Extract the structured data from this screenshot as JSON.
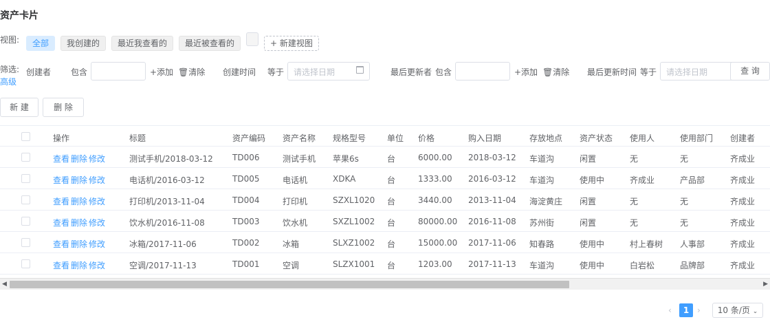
{
  "page_title": "资产卡片",
  "views": {
    "label": "视图:",
    "items": [
      "全部",
      "我创建的",
      "最近我查看的",
      "最近被查看的"
    ],
    "new_view": "+ 新建视图"
  },
  "filter": {
    "label": "筛选:",
    "advanced": "高级",
    "creator_label": "创建者",
    "creator_op": "包含",
    "add": "+添加",
    "clear": "清除",
    "created_label": "创建时间",
    "created_op": "等于",
    "date_placeholder": "请选择日期",
    "updater_label": "最后更新者",
    "updater_op": "包含",
    "updated_label": "最后更新时间",
    "updated_op": "等于",
    "query": "查 询"
  },
  "toolbar": {
    "new": "新 建",
    "delete": "删 除"
  },
  "table": {
    "headers": [
      "操作",
      "标题",
      "资产编码",
      "资产名称",
      "规格型号",
      "单位",
      "价格",
      "购入日期",
      "存放地点",
      "资产状态",
      "使用人",
      "使用部门",
      "创建者"
    ],
    "actions": [
      "查看",
      "删除",
      "修改"
    ],
    "rows": [
      [
        "测试手机/2018-03-12",
        "TD006",
        "测试手机",
        "苹果6s",
        "台",
        "6000.00",
        "2018-03-12",
        "车道沟",
        "闲置",
        "无",
        "无",
        "齐成业"
      ],
      [
        "电话机/2016-03-12",
        "TD005",
        "电话机",
        "XDKA",
        "台",
        "1333.00",
        "2016-03-12",
        "车道沟",
        "使用中",
        "齐成业",
        "产品部",
        "齐成业"
      ],
      [
        "打印机/2013-11-04",
        "TD004",
        "打印机",
        "SZXL1020",
        "台",
        "3440.00",
        "2013-11-04",
        "海淀黄庄",
        "闲置",
        "无",
        "无",
        "齐成业"
      ],
      [
        "饮水机/2016-11-08",
        "TD003",
        "饮水机",
        "SXZL1002",
        "台",
        "80000.00",
        "2016-11-08",
        "苏州街",
        "闲置",
        "无",
        "无",
        "齐成业"
      ],
      [
        "冰箱/2017-11-06",
        "TD002",
        "冰箱",
        "SLXZ1002",
        "台",
        "15000.00",
        "2017-11-06",
        "知春路",
        "使用中",
        "村上春树",
        "人事部",
        "齐成业"
      ],
      [
        "空调/2017-11-13",
        "TD001",
        "空调",
        "SLZX1001",
        "台",
        "1203.00",
        "2017-11-13",
        "车道沟",
        "使用中",
        "白岩松",
        "品牌部",
        "齐成业"
      ]
    ]
  },
  "pagination": {
    "current_page": "1",
    "page_size": "10 条/页"
  },
  "colors": {
    "accent": "#409eff",
    "active_view_bg": "#d9ecff"
  }
}
